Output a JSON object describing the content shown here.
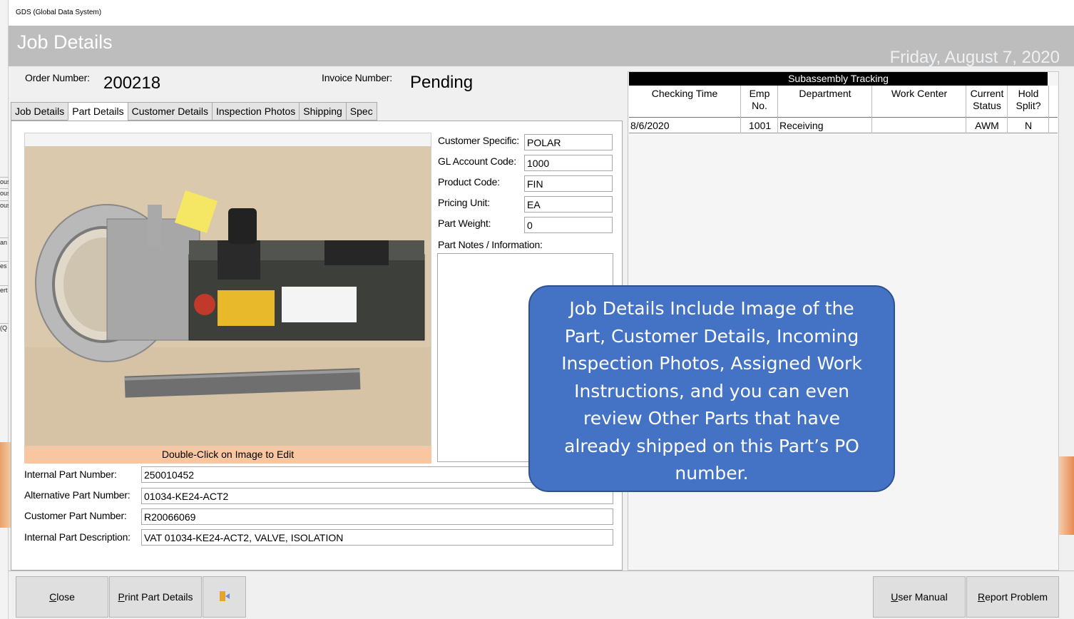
{
  "window": {
    "title": "GDS (Global Data System)"
  },
  "header": {
    "title": "Job Details",
    "date": "Friday, August 7, 2020"
  },
  "order": {
    "order_label": "Order Number:",
    "order_value": "200218",
    "invoice_label": "Invoice Number:",
    "invoice_value": "Pending"
  },
  "tabs": [
    {
      "label": "Job Details"
    },
    {
      "label": "Part Details"
    },
    {
      "label": "Customer Details"
    },
    {
      "label": "Inspection Photos"
    },
    {
      "label": "Shipping"
    },
    {
      "label": "Spec"
    }
  ],
  "photo": {
    "caption": "Double-Click on Image to Edit"
  },
  "part_fields": {
    "customer_specific": {
      "label": "Customer Specific:",
      "value": "POLAR"
    },
    "gl_account": {
      "label": "GL Account Code:",
      "value": "1000"
    },
    "product_code": {
      "label": "Product Code:",
      "value": "FIN"
    },
    "pricing_unit": {
      "label": "Pricing Unit:",
      "value": "EA"
    },
    "part_weight": {
      "label": "Part Weight:",
      "value": "0"
    },
    "notes_label": "Part Notes / Information:"
  },
  "part_numbers": {
    "internal": {
      "label": "Internal Part Number:",
      "value": "250010452"
    },
    "alternative": {
      "label": "Alternative Part Number:",
      "value": "01034-KE24-ACT2"
    },
    "customer": {
      "label": "Customer Part Number:",
      "value": "R20066069"
    },
    "description": {
      "label": "Internal Part Description:",
      "value": "VAT 01034-KE24-ACT2, VALVE, ISOLATION"
    }
  },
  "tracking": {
    "title": "Subassembly Tracking",
    "columns": [
      "Checking Time",
      "Emp No.",
      "Department",
      "Work Center",
      "Current Status",
      "Hold Split?"
    ],
    "rows": [
      {
        "checking_time": "8/6/2020",
        "emp_no": "1001",
        "department": "Receiving",
        "work_center": "",
        "current_status": "AWM",
        "hold_split": "N"
      }
    ]
  },
  "buttons": {
    "close_u": "C",
    "close_rest": "lose",
    "print_u": "P",
    "print_rest": "rint Part Details",
    "manual_u": "U",
    "manual_rest": "ser Manual",
    "report_u": "R",
    "report_rest": "eport Problem"
  },
  "callout": {
    "text": "Job Details Include Image of the Part, Customer Details, Incoming Inspection Photos, Assigned Work Instructions, and you can even review Other Parts that have already shipped on this Part’s PO number."
  },
  "background_app": {
    "stripes": [
      "ous",
      "ous",
      "ous",
      "an",
      "es",
      "ert",
      "(Q"
    ]
  },
  "colors": {
    "header_bg": "#bdbdbd",
    "callout_bg": "#4472c4",
    "caption_bg": "#f8c6a0",
    "tracking_title_bg": "#000000"
  }
}
